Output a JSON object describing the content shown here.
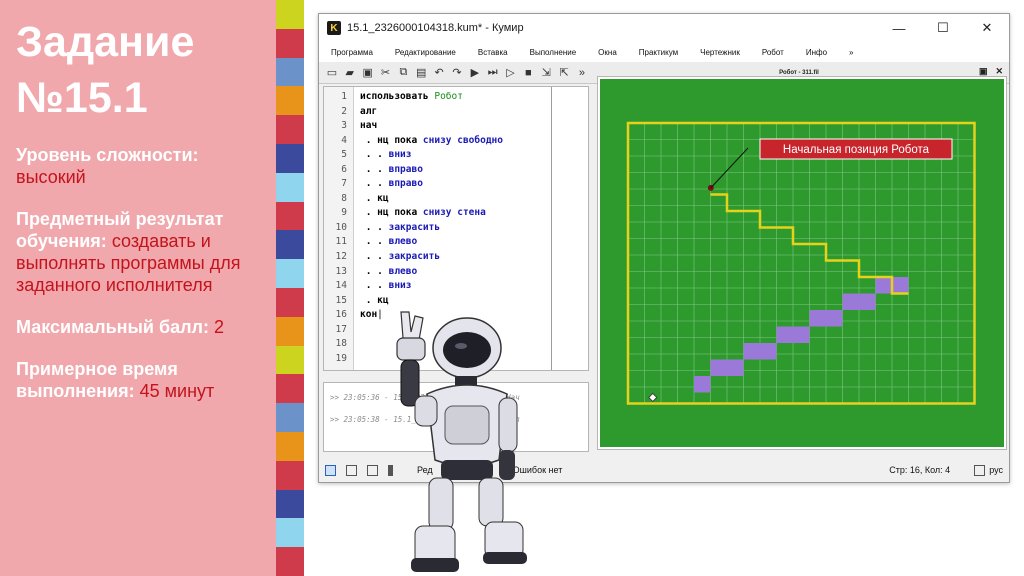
{
  "slide": {
    "title_line1": "Задание",
    "title_line2": "№15.1",
    "difficulty_label": "Уровень сложности:",
    "difficulty_value": "высокий",
    "result_label": "Предметный результат обучения:",
    "result_value": "создавать и выполнять программы для заданного исполнителя",
    "max_score_label": "Максимальный балл:",
    "max_score_value": "2",
    "time_label": "Примерное время выполнения:",
    "time_value": "45 минут"
  },
  "stripe_colors": [
    "#ccd41f",
    "#cf3b4b",
    "#6b92c9",
    "#e8931a",
    "#cf3b4b",
    "#3c4a9e",
    "#8fd5ee",
    "#cf3b4b",
    "#3c4a9e",
    "#8fd5ee",
    "#cf3b4b",
    "#e8931a",
    "#ccd41f",
    "#cf3b4b",
    "#6b92c9",
    "#e8931a",
    "#cf3b4b",
    "#3c4a9e",
    "#8fd5ee",
    "#cf3b4b"
  ],
  "window": {
    "title": "15.1_2326000104318.kum* - Кумир",
    "app_icon_letter": "K",
    "controls": [
      "—",
      "☐",
      "✕"
    ]
  },
  "menu": [
    "Программа",
    "Редактирование",
    "Вставка",
    "Выполнение",
    "Окна",
    "Практикум",
    "Чертежник",
    "Робот",
    "Инфо",
    "»"
  ],
  "robot_panel_title": "Робот - 311.fil",
  "code_lines": [
    [
      {
        "t": "использовать ",
        "c": "kw"
      },
      {
        "t": "Робот",
        "c": "nm"
      }
    ],
    [
      {
        "t": "алг",
        "c": "kw"
      }
    ],
    [
      {
        "t": "нач",
        "c": "kw"
      }
    ],
    [
      {
        "t": " . нц пока ",
        "c": "kw"
      },
      {
        "t": "снизу свободно",
        "c": "cmd"
      }
    ],
    [
      {
        "t": " . . ",
        "c": "kw"
      },
      {
        "t": "вниз",
        "c": "cmd"
      }
    ],
    [
      {
        "t": " . . ",
        "c": "kw"
      },
      {
        "t": "вправо",
        "c": "cmd"
      }
    ],
    [
      {
        "t": " . . ",
        "c": "kw"
      },
      {
        "t": "вправо",
        "c": "cmd"
      }
    ],
    [
      {
        "t": " . кц",
        "c": "kw"
      }
    ],
    [
      {
        "t": " . нц пока ",
        "c": "kw"
      },
      {
        "t": "снизу стена",
        "c": "cmd"
      }
    ],
    [
      {
        "t": " . . ",
        "c": "kw"
      },
      {
        "t": "закрасить",
        "c": "cmd"
      }
    ],
    [
      {
        "t": " . . ",
        "c": "kw"
      },
      {
        "t": "влево",
        "c": "cmd"
      }
    ],
    [
      {
        "t": " . . ",
        "c": "kw"
      },
      {
        "t": "закрасить",
        "c": "cmd"
      }
    ],
    [
      {
        "t": " . . ",
        "c": "kw"
      },
      {
        "t": "влево",
        "c": "cmd"
      }
    ],
    [
      {
        "t": " . . ",
        "c": "kw"
      },
      {
        "t": "вниз",
        "c": "cmd"
      }
    ],
    [
      {
        "t": " . кц",
        "c": "kw"
      }
    ],
    [
      {
        "t": "кон",
        "c": "kw"
      }
    ],
    [],
    [],
    []
  ],
  "line_numbers": [
    "1",
    "2",
    "3",
    "4",
    "5",
    "6",
    "7",
    "8",
    "9",
    "10",
    "11",
    "12",
    "13",
    "14",
    "15",
    "16",
    "17",
    "18",
    "19"
  ],
  "console_lines": [
    ">> 23:05:36 - 15.1_2326000104318.kum - Нач",
    ">> 23:05:38 - 15.1_2326000104318.kum - Вып"
  ],
  "field": {
    "callout": "Начальная позиция Робота",
    "green": "#2e9a2e",
    "wall": "#e6d21a",
    "painted": "#9b79d8",
    "gridline": "#7fc77f"
  },
  "status": {
    "mode": "Ред",
    "errors": "Ошибок нет",
    "position": "Стр: 16, Кол: 4",
    "lang": "рус"
  }
}
